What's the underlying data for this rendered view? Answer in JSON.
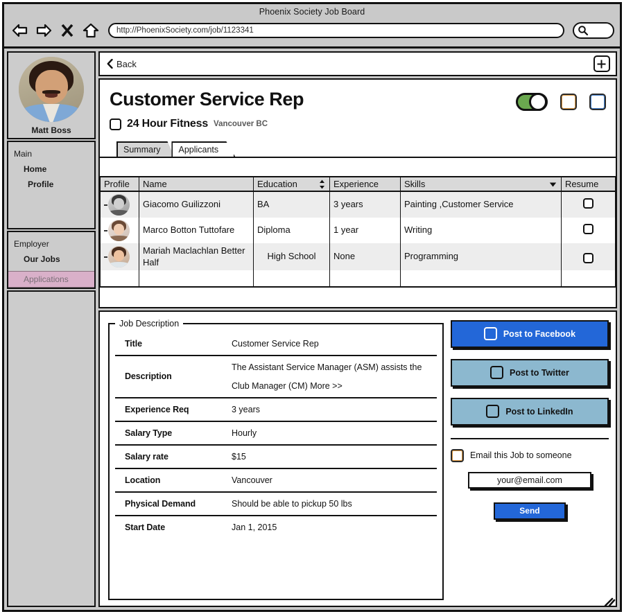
{
  "window": {
    "title": "Phoenix Society Job Board",
    "url": "http://PhoenixSociety.com/job/1123341"
  },
  "browser_nav": {
    "back_icon": "back-arrow-icon",
    "forward_icon": "forward-arrow-icon",
    "stop_icon": "stop-x-icon",
    "home_icon": "home-icon",
    "search_icon": "search-icon"
  },
  "sidebar": {
    "profile": {
      "name": "Matt Boss",
      "avatar_icon": "user-photo-avatar"
    },
    "groups": [
      {
        "label": "Main",
        "items": [
          {
            "label": "Home",
            "active": false
          },
          {
            "label": "Profile",
            "active": false
          }
        ]
      },
      {
        "label": "Employer",
        "items": [
          {
            "label": "Our Jobs",
            "active": false
          },
          {
            "label": "Applications",
            "active": true
          }
        ]
      }
    ],
    "active_highlight_color": "#d9b0c9"
  },
  "topbar": {
    "back_label": "Back",
    "back_icon": "chevron-left-icon",
    "add_icon": "plus-icon"
  },
  "job_header": {
    "title": "Customer Service Rep",
    "company": "24 Hour Fitness",
    "location": "Vancouver BC",
    "company_checkbox_checked": false,
    "toggle_on": true,
    "toggle_on_color": "#6aa84f",
    "extra_checkbox_1_checked": false,
    "extra_checkbox_2_checked": false
  },
  "tabs": [
    {
      "label": "Summary",
      "active": false
    },
    {
      "label": "Applicants",
      "active": true
    }
  ],
  "applicants_table": {
    "columns": [
      {
        "label": "Profile",
        "sort_icon": ""
      },
      {
        "label": "Name",
        "sort_icon": ""
      },
      {
        "label": "Education",
        "sort_icon": "sort-updown-icon"
      },
      {
        "label": "Experience",
        "sort_icon": ""
      },
      {
        "label": "Skills",
        "sort_icon": "dropdown-caret-icon"
      },
      {
        "label": "Resume",
        "sort_icon": ""
      }
    ],
    "rows": [
      {
        "profile_icon": "applicant-avatar",
        "name": "Giacomo Guilizzoni",
        "education": "BA",
        "experience": "3 years",
        "skills": "Painting ,Customer Service",
        "resume_checked": false
      },
      {
        "profile_icon": "applicant-avatar",
        "name": "Marco Botton Tuttofare",
        "education": "Diploma",
        "experience": "1 year",
        "skills": "Writing",
        "resume_checked": false
      },
      {
        "profile_icon": "applicant-avatar",
        "name": "Mariah Maclachlan Better Half",
        "education": "High School",
        "experience": "None",
        "skills": "Programming",
        "resume_checked": false
      }
    ]
  },
  "job_description": {
    "legend": "Job Description",
    "fields": [
      {
        "label": "Title",
        "value": "Customer Service Rep",
        "value2": ""
      },
      {
        "label": "Description",
        "value": "The Assistant Service Manager (ASM) assists the",
        "value2": "Club Manager (CM) More >>"
      },
      {
        "label": "Experience Req",
        "value": "3 years",
        "value2": ""
      },
      {
        "label": "Salary Type",
        "value": "Hourly",
        "value2": ""
      },
      {
        "label": "Salary rate",
        "value": "$15",
        "value2": ""
      },
      {
        "label": "Location",
        "value": "Vancouver",
        "value2": ""
      },
      {
        "label": "Physical Demand",
        "value": "Should be able to pickup 50 lbs",
        "value2": ""
      },
      {
        "label": "Start Date",
        "value": "Jan 1, 2015",
        "value2": ""
      }
    ]
  },
  "share_panel": {
    "facebook": {
      "label": "Post to Facebook",
      "color": "#2367d8",
      "checked": false
    },
    "twitter": {
      "label": "Post to Twitter",
      "color": "#8cb8cf",
      "checked": false
    },
    "linkedin": {
      "label": "Post to LinkedIn",
      "color": "#8cb8cf",
      "checked": false
    },
    "email_checkbox_label": "Email this Job to someone",
    "email_checkbox_checked": false,
    "email_value": "your@email.com",
    "email_placeholder": "your@email.com",
    "send_label": "Send",
    "send_color": "#2367d8"
  }
}
